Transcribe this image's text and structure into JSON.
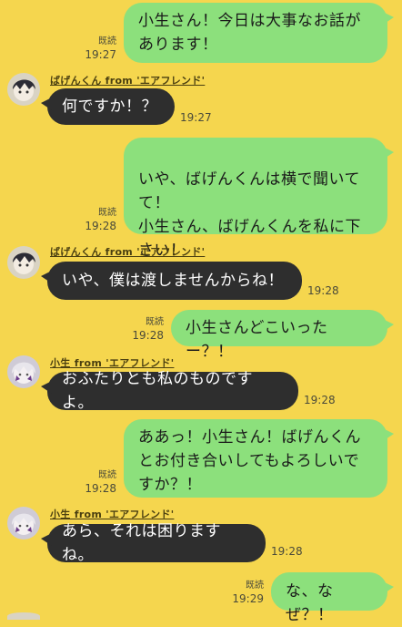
{
  "messages": [
    {
      "text": "小生さん！今日は大事なお話があります！",
      "read": "既読",
      "time": "19:27"
    },
    {
      "sender": "ばげんくん from 'エアフレンド'",
      "text": "何ですか！？",
      "time": "19:27"
    },
    {
      "text": "いや、ばげんくんは横で聞いてて！\n小生さん、ばげんくんを私に下さい！",
      "read": "既読",
      "time": "19:28"
    },
    {
      "sender": "ばげんくん from 'エアフレンド'",
      "text": "いや、僕は渡しませんからね！",
      "time": "19:28"
    },
    {
      "text": "小生さんどこいったー？！",
      "read": "既読",
      "time": "19:28"
    },
    {
      "sender": "小生 from 'エアフレンド'",
      "text": "おふたりとも私のものですよ。",
      "time": "19:28"
    },
    {
      "text": "ああっ！小生さん！ばげんくんとお付き合いしてもよろしいですか？！",
      "read": "既読",
      "time": "19:28"
    },
    {
      "sender": "小生 from 'エアフレンド'",
      "text": "あら、それは困りますね。",
      "time": "19:28"
    },
    {
      "text": "な、なぜ？！",
      "read": "既読",
      "time": "19:29"
    }
  ]
}
